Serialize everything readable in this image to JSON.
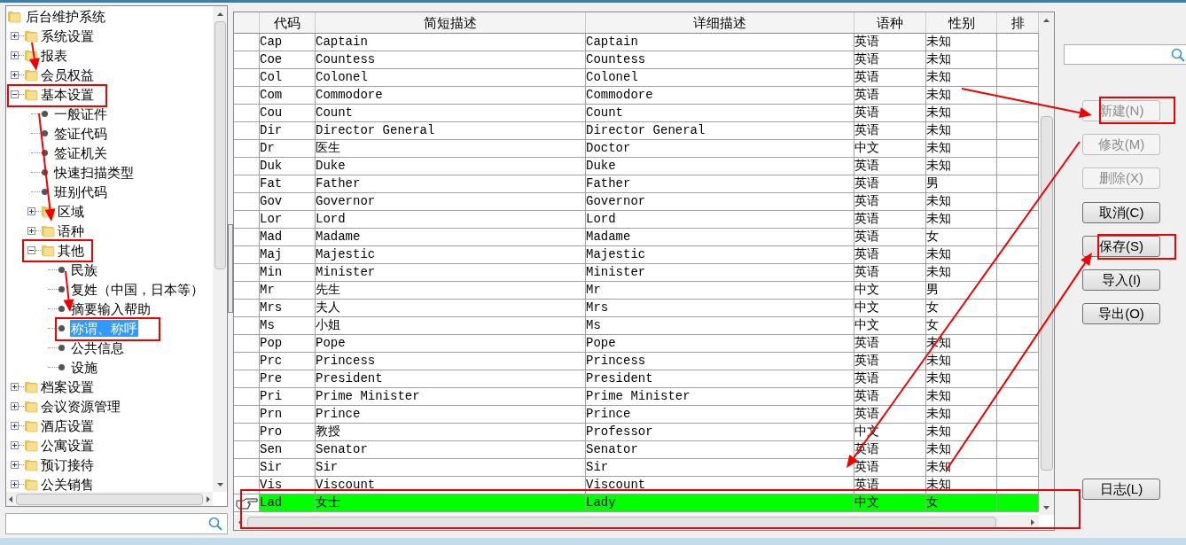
{
  "tree": {
    "label": "后台维护系统",
    "kind": "folder",
    "selected": false,
    "children": [
      {
        "label": "系统设置",
        "kind": "folder",
        "expanded": false,
        "selected": false
      },
      {
        "label": "报表",
        "kind": "folder",
        "expanded": false,
        "selected": false
      },
      {
        "label": "会员权益",
        "kind": "folder",
        "expanded": false,
        "selected": false
      },
      {
        "label": "基本设置",
        "kind": "folder",
        "expanded": true,
        "selected": false,
        "children": [
          {
            "label": "一般证件",
            "kind": "leaf",
            "selected": false
          },
          {
            "label": "签证代码",
            "kind": "leaf",
            "selected": false
          },
          {
            "label": "签证机关",
            "kind": "leaf",
            "selected": false
          },
          {
            "label": "快速扫描类型",
            "kind": "leaf",
            "selected": false
          },
          {
            "label": "班别代码",
            "kind": "leaf",
            "selected": false
          },
          {
            "label": "区域",
            "kind": "folder",
            "expanded": false,
            "selected": false
          },
          {
            "label": "语种",
            "kind": "folder",
            "expanded": false,
            "selected": false
          },
          {
            "label": "其他",
            "kind": "folder",
            "expanded": true,
            "selected": false,
            "children": [
              {
                "label": "民族",
                "kind": "leaf",
                "selected": false
              },
              {
                "label": "复姓（中国，日本等）",
                "kind": "leaf",
                "selected": false
              },
              {
                "label": "摘要输入帮助",
                "kind": "leaf",
                "selected": false
              },
              {
                "label": "称谓、称呼",
                "kind": "leaf",
                "selected": true
              },
              {
                "label": "公共信息",
                "kind": "leaf",
                "selected": false
              },
              {
                "label": "设施",
                "kind": "leaf",
                "selected": false
              }
            ]
          }
        ]
      },
      {
        "label": "档案设置",
        "kind": "folder",
        "expanded": false,
        "selected": false
      },
      {
        "label": "会议资源管理",
        "kind": "folder",
        "expanded": false,
        "selected": false
      },
      {
        "label": "酒店设置",
        "kind": "folder",
        "expanded": false,
        "selected": false
      },
      {
        "label": "公寓设置",
        "kind": "folder",
        "expanded": false,
        "selected": false
      },
      {
        "label": "预订接待",
        "kind": "folder",
        "expanded": false,
        "selected": false
      },
      {
        "label": "公关销售",
        "kind": "folder",
        "expanded": false,
        "selected": false
      }
    ]
  },
  "table": {
    "columns": [
      "代码",
      "简短描述",
      "详细描述",
      "语种",
      "性别",
      "排"
    ],
    "rows": [
      {
        "cells": [
          "Cap",
          "Captain",
          "Captain",
          "英语",
          "未知"
        ],
        "selected": false
      },
      {
        "cells": [
          "Coe",
          "Countess",
          "Countess",
          "英语",
          "未知"
        ],
        "selected": false
      },
      {
        "cells": [
          "Col",
          "Colonel",
          "Colonel",
          "英语",
          "未知"
        ],
        "selected": false
      },
      {
        "cells": [
          "Com",
          "Commodore",
          "Commodore",
          "英语",
          "未知"
        ],
        "selected": false
      },
      {
        "cells": [
          "Cou",
          "Count",
          "Count",
          "英语",
          "未知"
        ],
        "selected": false
      },
      {
        "cells": [
          "Dir",
          "Director General",
          "Director General",
          "英语",
          "未知"
        ],
        "selected": false
      },
      {
        "cells": [
          "Dr",
          "医生",
          "Doctor",
          "中文",
          "未知"
        ],
        "selected": false
      },
      {
        "cells": [
          "Duk",
          "Duke",
          "Duke",
          "英语",
          "未知"
        ],
        "selected": false
      },
      {
        "cells": [
          "Fat",
          "Father",
          "Father",
          "英语",
          "男"
        ],
        "selected": false
      },
      {
        "cells": [
          "Gov",
          "Governor",
          "Governor",
          "英语",
          "未知"
        ],
        "selected": false
      },
      {
        "cells": [
          "Lor",
          "Lord",
          "Lord",
          "英语",
          "未知"
        ],
        "selected": false
      },
      {
        "cells": [
          "Mad",
          "Madame",
          "Madame",
          "英语",
          "女"
        ],
        "selected": false
      },
      {
        "cells": [
          "Maj",
          "Majestic",
          "Majestic",
          "英语",
          "未知"
        ],
        "selected": false
      },
      {
        "cells": [
          "Min",
          "Minister",
          "Minister",
          "英语",
          "未知"
        ],
        "selected": false
      },
      {
        "cells": [
          "Mr",
          "先生",
          "Mr",
          "中文",
          "男"
        ],
        "selected": false
      },
      {
        "cells": [
          "Mrs",
          "夫人",
          "Mrs",
          "中文",
          "女"
        ],
        "selected": false
      },
      {
        "cells": [
          "Ms",
          "小姐",
          "Ms",
          "中文",
          "女"
        ],
        "selected": false
      },
      {
        "cells": [
          "Pop",
          "Pope",
          "Pope",
          "英语",
          "未知"
        ],
        "selected": false
      },
      {
        "cells": [
          "Prc",
          "Princess",
          "Princess",
          "英语",
          "未知"
        ],
        "selected": false
      },
      {
        "cells": [
          "Pre",
          "President",
          "President",
          "英语",
          "未知"
        ],
        "selected": false
      },
      {
        "cells": [
          "Pri",
          "Prime Minister",
          "Prime Minister",
          "英语",
          "未知"
        ],
        "selected": false
      },
      {
        "cells": [
          "Prn",
          "Prince",
          "Prince",
          "英语",
          "未知"
        ],
        "selected": false
      },
      {
        "cells": [
          "Pro",
          "教授",
          "Professor",
          "中文",
          "未知"
        ],
        "selected": false
      },
      {
        "cells": [
          "Sen",
          "Senator",
          "Senator",
          "英语",
          "未知"
        ],
        "selected": false
      },
      {
        "cells": [
          "Sir",
          "Sir",
          "Sir",
          "英语",
          "未知"
        ],
        "selected": false
      },
      {
        "cells": [
          "Vis",
          "Viscount",
          "Viscount",
          "英语",
          "未知"
        ],
        "selected": false
      },
      {
        "cells": [
          "Lad",
          "女士",
          "Lady",
          "中文",
          "女"
        ],
        "selected": true
      }
    ]
  },
  "buttons": [
    {
      "label": "新建(N)",
      "disabled": true
    },
    {
      "label": "修改(M)",
      "disabled": true
    },
    {
      "label": "删除(X)",
      "disabled": true
    },
    {
      "label": "取消(C)",
      "disabled": false
    },
    {
      "label": "保存(S)",
      "disabled": false
    },
    {
      "label": "导入(I)",
      "disabled": false
    },
    {
      "label": "导出(O)",
      "disabled": false
    },
    {
      "label": "日志(L)",
      "disabled": false
    }
  ]
}
